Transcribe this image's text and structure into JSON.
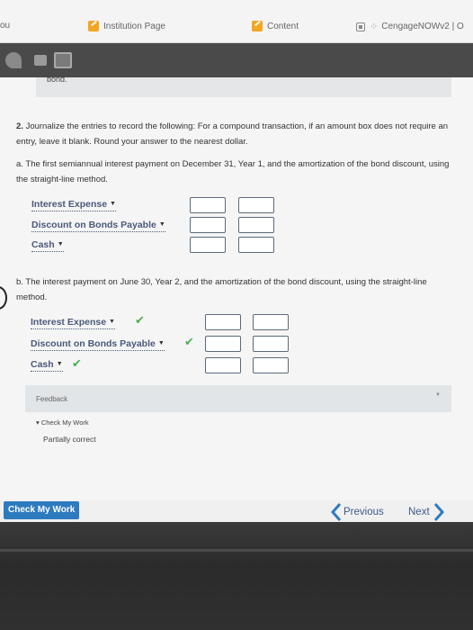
{
  "bookmarks": {
    "left_partial": "ou",
    "institution": "Institution Page",
    "content": "Content",
    "cengage": "CengageNOWv2 | O"
  },
  "context_fragment": "bond.",
  "question": {
    "number": "2.",
    "prompt": "Journalize the entries to record the following: For a compound transaction, if an amount box does not require an entry, leave it blank. Round your answer to the nearest dollar."
  },
  "part_a": {
    "text": "a. The first semiannual interest payment on December 31, Year 1, and the amortization of the bond discount, using the straight-line method.",
    "rows": [
      {
        "account": "Interest Expense",
        "correct": false
      },
      {
        "account": "Discount on Bonds Payable",
        "correct": false
      },
      {
        "account": "Cash",
        "correct": false
      }
    ]
  },
  "part_b": {
    "text": "b. The interest payment on June 30, Year 2, and the amortization of the bond discount, using the straight-line method.",
    "rows": [
      {
        "account": "Interest Expense",
        "correct": true
      },
      {
        "account": "Discount on Bonds Payable",
        "correct": true
      },
      {
        "account": "Cash",
        "correct": true
      }
    ]
  },
  "feedback": {
    "label": "Feedback",
    "check_my_work": "Check My Work",
    "status": "Partially correct"
  },
  "nav": {
    "check_my_work": "Check My Work",
    "previous": "Previous",
    "next": "Next"
  },
  "colors": {
    "accent": "#2d7bbf",
    "account_link": "#4a5a7a",
    "check": "#4caf50"
  }
}
